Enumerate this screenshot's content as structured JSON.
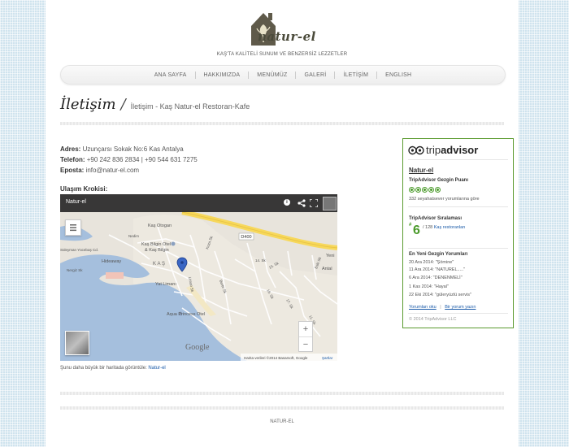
{
  "header": {
    "logo_text": "natur-el",
    "tagline": "KAŞ'TA KALİTELİ SUNUM VE BENZERSİZ LEZZETLER"
  },
  "nav": {
    "items": [
      {
        "label": "ANA SAYFA"
      },
      {
        "label": "HAKKIMIZDA"
      },
      {
        "label": "MENÜMÜZ"
      },
      {
        "label": "GALERİ"
      },
      {
        "label": "İLETİŞİM"
      },
      {
        "label": "ENGLISH"
      }
    ]
  },
  "page": {
    "title": "İletişim",
    "breadcrumb": "İletişim - Kaş Natur-el Restoran-Kafe"
  },
  "contact": {
    "address_label": "Adres:",
    "address_value": "Uzunçarsı Sokak No:6 Kas Antalya",
    "phone_label": "Telefon:",
    "phone_value": "+90 242 836 2834 | +90 544 631 7275",
    "email_label": "Eposta:",
    "email_value": "info@natur-el.com",
    "map_label": "Ulaşım Krokisi:"
  },
  "map": {
    "title": "Natur-el",
    "labels": {
      "otogar": "Kaş Otogarı",
      "bilgin": "Kaş Bilgin Otel",
      "bilgin2": "& Kaş Bilgin",
      "hideaway": "Hideaway",
      "kas": "KAŞ",
      "yatlimani": "Yat Limanı",
      "aqua": "Aqua Princess Otel",
      "road": "D400",
      "yeni": "Yeni",
      "antalya": "Antal",
      "suleyman": "Süleyman Yücebaş Cd.",
      "nergiz": "Nergiz Sk",
      "nedim": "Nedim",
      "koza": "Koza Sk",
      "sk14": "14. Sk",
      "sk15": "15. Sk",
      "sk16": "16. Sk",
      "sk17": "17. Sk",
      "sk11": "11. Sk",
      "eski": "Eski Sk",
      "berte": "Berte Sk",
      "limon": "Limon Sk",
      "google": "Google"
    },
    "attribution": "Harita verileri ©2014 Basarsoft, Google",
    "terms": "Şartlar",
    "zoom_in": "+",
    "zoom_out": "−",
    "caption_prefix": "Şunu daha büyük bir haritada görüntüle: ",
    "caption_link": "Natur-el"
  },
  "tripadvisor": {
    "logo_prefix": "trip",
    "logo_suffix": "advisor",
    "name": "Natur-el",
    "rating_title": "TripAdvisor Gezgin Puanı",
    "rating_value": 5,
    "review_count_text": "332 seyahatsever yorumlarına göre",
    "rank_title": "TripAdvisor Sıralaması",
    "rank_hash": "#",
    "rank_number": "6",
    "rank_text_prefix": "/ 128 ",
    "rank_text_link": "Kaş restoranları",
    "latest_title": "En Yeni Gezgin Yorumları",
    "reviews": [
      {
        "date": "20 Ara 2014: ",
        "quote": "\"Şömine\""
      },
      {
        "date": "11 Ara 2014: ",
        "quote": "\"NATUREL.....\""
      },
      {
        "date": "6 Ara 2014: ",
        "quote": "\"DENENMELİ\""
      },
      {
        "date": "1 Kas 2014: ",
        "quote": "\"Hayal\""
      },
      {
        "date": "22 Eki 2014: ",
        "quote": "\"güleryüzlü servis\""
      }
    ],
    "read_reviews": "Yorumları oku",
    "sep": "|",
    "write_review": "Bir yorum yazın",
    "copyright": "© 2014 TripAdvisor LLC"
  },
  "footer": {
    "text": "NATUR-EL"
  },
  "colors": {
    "tripadvisor_green": "#4a9a2a",
    "link_blue": "#1a5aa8",
    "map_water": "#a5bfdd",
    "map_land": "#e8e4dc",
    "map_road": "#f7d85b"
  }
}
